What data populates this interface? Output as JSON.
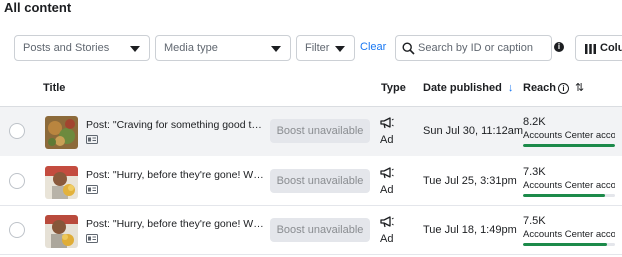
{
  "header": {
    "title": "All content"
  },
  "filters": {
    "content_select": "Posts and Stories",
    "media_select": "Media type",
    "filter_select": "Filter",
    "clear_label": "Clear",
    "search_placeholder": "Search by ID or caption",
    "columns_label": "Colu"
  },
  "table": {
    "columns": {
      "title": "Title",
      "type": "Type",
      "date": "Date published",
      "date_sort": "↓",
      "reach": "Reach",
      "reach_sort": "⇅"
    },
    "rows": [
      {
        "post": "Post: \"Craving for something good to eat...",
        "boost": "Boost unavailable",
        "type": "Ad",
        "date": "Sun Jul 30, 11:12am",
        "reach": "8.2K",
        "reach_source": "Accounts Center accou...",
        "reach_fraction": 1.0
      },
      {
        "post": "Post: \"Hurry, before they're gone! With o...",
        "boost": "Boost unavailable",
        "type": "Ad",
        "date": "Tue Jul 25, 3:31pm",
        "reach": "7.3K",
        "reach_source": "Accounts Center accou...",
        "reach_fraction": 0.89
      },
      {
        "post": "Post: \"Hurry, before they're gone! With o...",
        "boost": "Boost unavailable",
        "type": "Ad",
        "date": "Tue Jul 18, 1:49pm",
        "reach": "7.5K",
        "reach_source": "Accounts Center accou...",
        "reach_fraction": 0.91
      }
    ]
  },
  "colors": {
    "accent": "#1877f2",
    "reach_bar": "#1c8a4a",
    "selected_row": "#f2f3f5"
  },
  "icons": [
    "search-icon",
    "info-icon",
    "columns-icon",
    "chevron-down-icon",
    "megaphone-icon",
    "post-icon"
  ]
}
